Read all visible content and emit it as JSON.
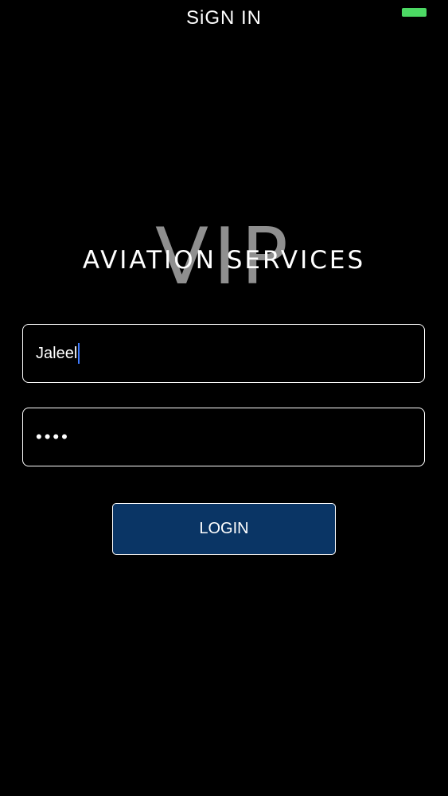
{
  "nav": {
    "title": "SiGN IN"
  },
  "status_bar": {
    "battery_color": "#4cd964",
    "battery_icon": "battery-icon"
  },
  "logo": {
    "vip_text": "VIP",
    "services_text": "AVIATION SERVICES"
  },
  "form": {
    "username_value": "Jaleel",
    "password_mask": "••••",
    "login_label": "LOGIN"
  },
  "colors": {
    "background": "#000000",
    "button_fill": "#0a3565",
    "cursor": "#3f7bff"
  }
}
